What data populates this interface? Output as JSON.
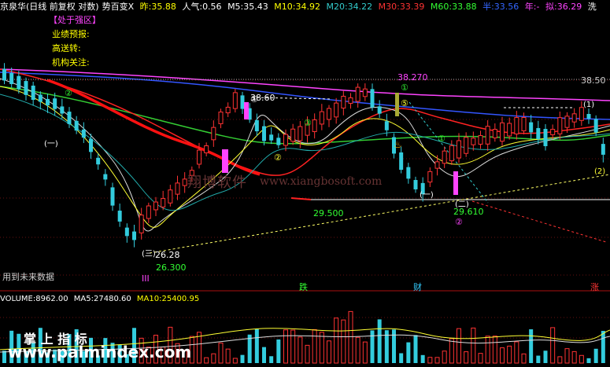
{
  "header": {
    "stock_name": "京泉华",
    "mode": "(日线 前复权 对数)",
    "indicator": "势百变X",
    "prev_close": {
      "label": "昨:",
      "value": "35.88"
    },
    "popularity": {
      "label": "人气:",
      "value": "0.56"
    },
    "m5": {
      "label": "M5:",
      "value": "35.43"
    },
    "m10": {
      "label": "M10:",
      "value": "34.92"
    },
    "m20": {
      "label": "M20:",
      "value": "34.22"
    },
    "m30": {
      "label": "M30:",
      "value": "33.39"
    },
    "m60": {
      "label": "M60:",
      "value": "33.88"
    },
    "half": {
      "label": "半:",
      "value": "33.56"
    },
    "year": {
      "label": "年:",
      "value": "-"
    },
    "proposed": {
      "label": "拟:",
      "value": "36.29"
    },
    "tail": "洗"
  },
  "info_panel": {
    "zone": "【处于强区】",
    "performance": "业绩预报:",
    "bonus": "高送转:",
    "institution": "机构关注:"
  },
  "chart_annotations": {
    "high_price": "38.270",
    "right_price": "38.50",
    "mid_price": "38.60",
    "low_left": "26.28",
    "low_left_green": "26.300",
    "low_mid": "29.500",
    "low_right": "29.610",
    "future_note": "用到未来数据",
    "roman_three": "III",
    "circle_labels": [
      "①",
      "②",
      "③",
      "④",
      "⑤"
    ],
    "paren_labels": [
      "(一)",
      "(二)",
      "(三)",
      "(1)",
      "(2)"
    ]
  },
  "markers": {
    "fall": "跌",
    "finance": "财",
    "rise": "涨"
  },
  "volume": {
    "label": "VOLUME:",
    "value": "8962.00",
    "ma5_label": "MA5:",
    "ma5": "27480.60",
    "ma10_label": "MA10:",
    "ma10": "25400.95"
  },
  "watermarks": {
    "cn": "翔博软件",
    "url": "www.xiangbosoft.com",
    "bottom_cn": "掌 上 指 标",
    "bottom_url": "www.palmindex.com"
  },
  "colors": {
    "up": "#ff3333",
    "down": "#33ccdd",
    "yellow": "#ffff00",
    "magenta": "#ff44ff",
    "green": "#33cc33",
    "blue": "#3355ff"
  }
}
